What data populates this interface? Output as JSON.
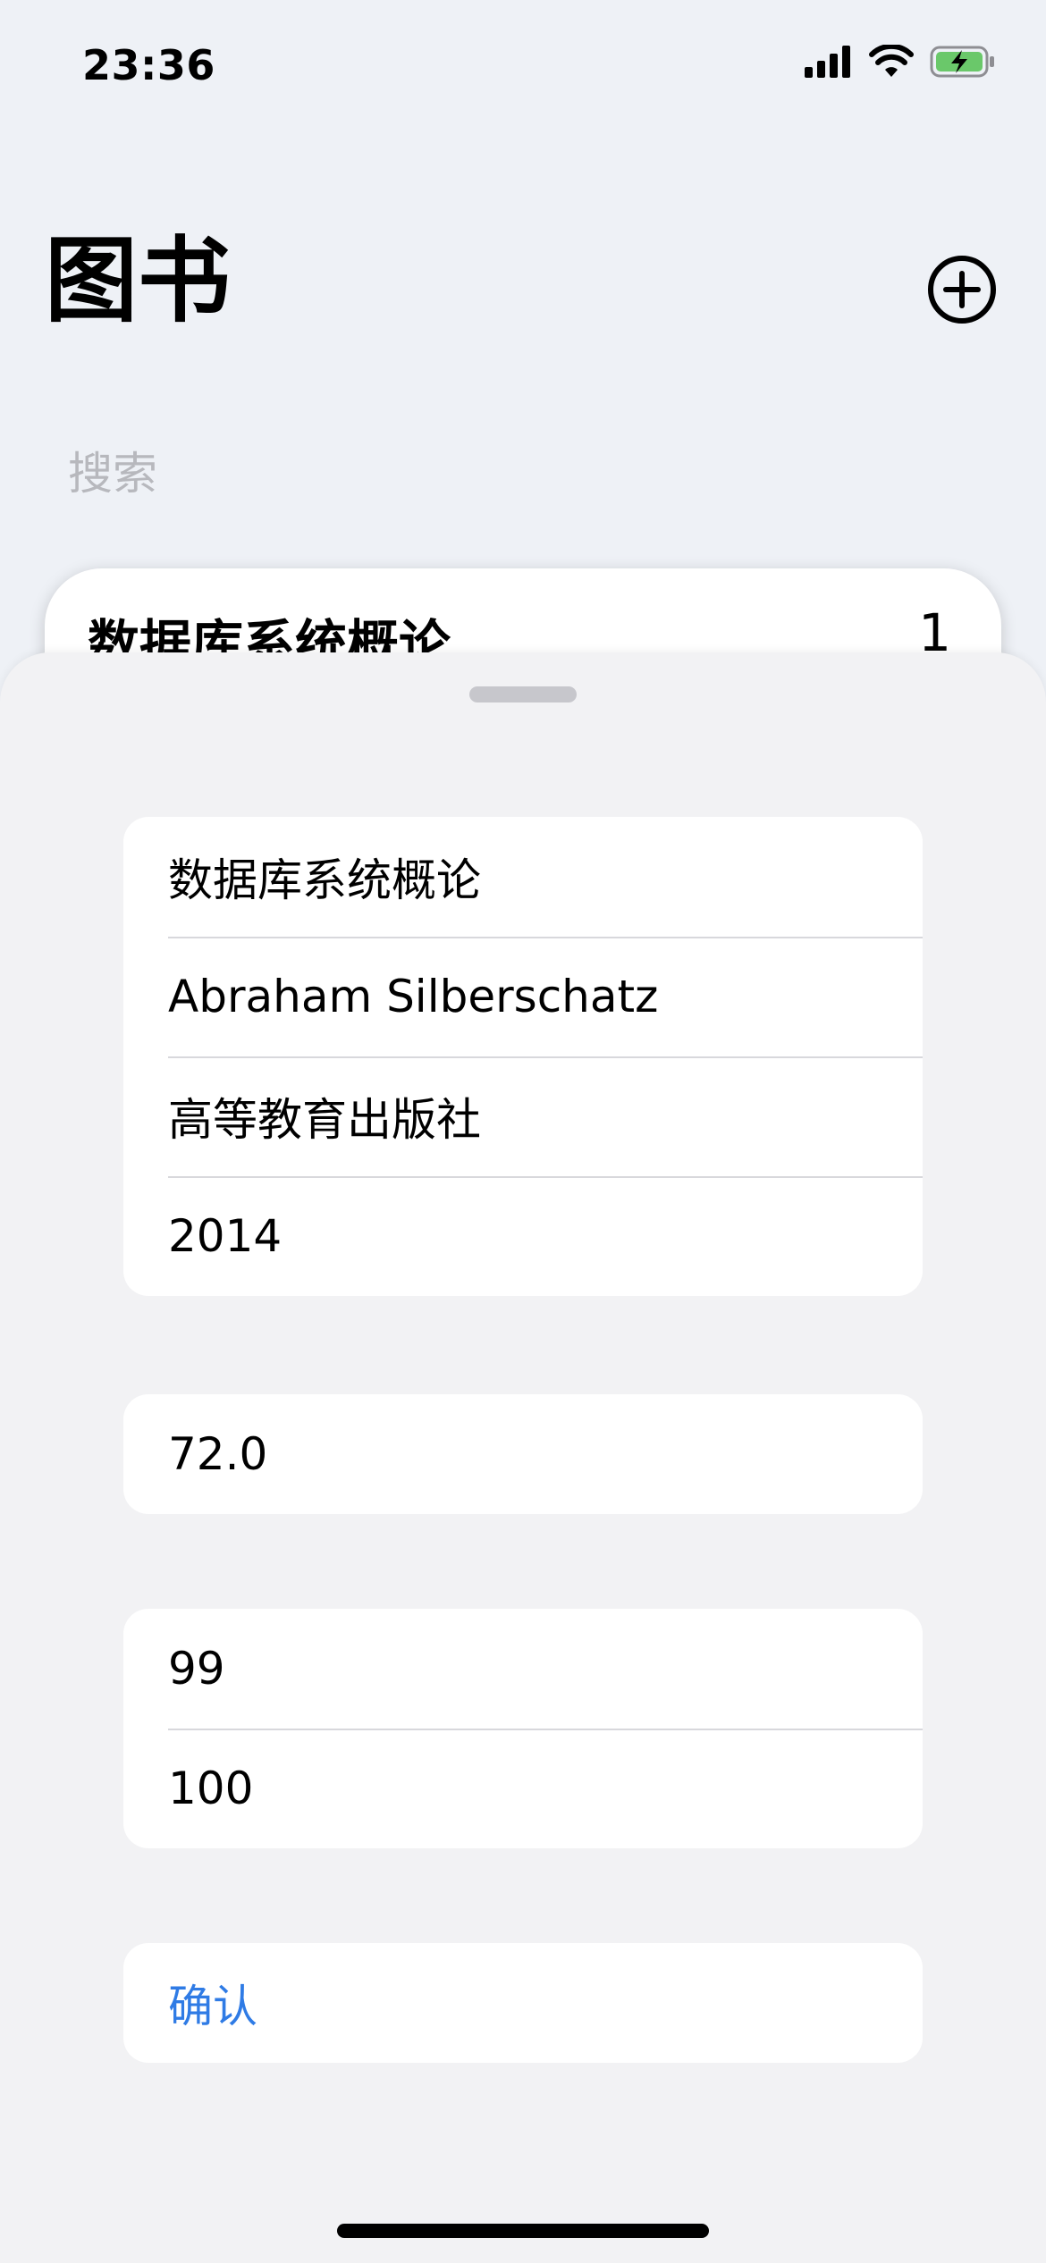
{
  "status_bar": {
    "time": "23:36",
    "icons": [
      "cellular-signal-icon",
      "wifi-icon",
      "battery-charging-icon"
    ]
  },
  "header": {
    "title": "图书",
    "add_icon": "plus-circle-icon"
  },
  "search": {
    "placeholder": "搜索"
  },
  "list": {
    "items": [
      {
        "title": "数据库系统概论",
        "count": "1"
      }
    ]
  },
  "sheet": {
    "book_info": {
      "title": "数据库系统概论",
      "author": "Abraham Silberschatz",
      "publisher": "高等教育出版社",
      "year": "2014"
    },
    "price": "72.0",
    "stock": {
      "available": "99",
      "total": "100"
    },
    "confirm_label": "确认"
  },
  "colors": {
    "background": "#eef1f6",
    "sheet_background": "#f2f2f4",
    "accent": "#2f7be5",
    "placeholder": "#b7b8bd",
    "battery": "#6ac86a"
  }
}
